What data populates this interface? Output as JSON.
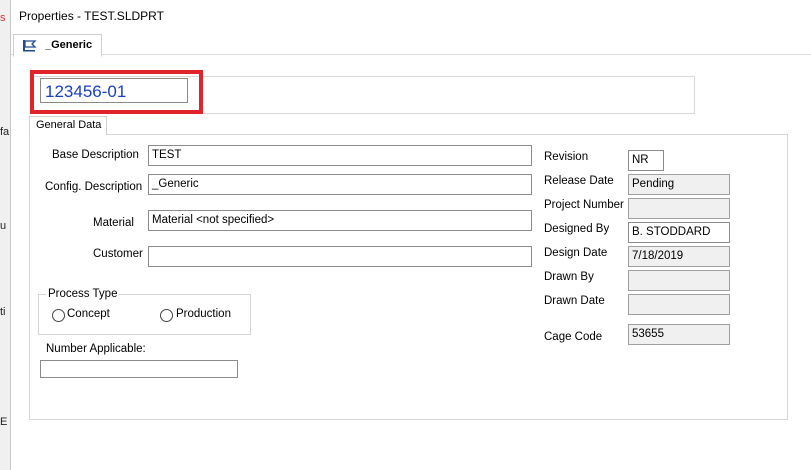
{
  "window": {
    "title": "Properties - TEST.SLDPRT"
  },
  "behind_fragments": [
    "s",
    "fa",
    "u",
    "ti",
    "E"
  ],
  "tabs": {
    "config_tab": "_Generic",
    "general_tab": "General Data"
  },
  "part_number": "123456-01",
  "left_fields": {
    "base_description": {
      "label": "Base Description",
      "value": "TEST"
    },
    "config_description": {
      "label": "Config. Description",
      "value": "_Generic"
    },
    "material": {
      "label": "Material",
      "value": "Material <not specified>"
    },
    "customer": {
      "label": "Customer",
      "value": ""
    }
  },
  "process_type": {
    "legend": "Process Type",
    "options": [
      "Concept",
      "Production"
    ]
  },
  "number_applicable": {
    "label": "Number Applicable:",
    "value": ""
  },
  "right_fields": {
    "revision": {
      "label": "Revision",
      "value": "NR"
    },
    "release_date": {
      "label": "Release Date",
      "value": "Pending"
    },
    "project_number": {
      "label": "Project Number",
      "value": ""
    },
    "designed_by": {
      "label": "Designed By",
      "value": "B. STODDARD"
    },
    "design_date": {
      "label": "Design Date",
      "value": "7/18/2019"
    },
    "drawn_by": {
      "label": "Drawn By",
      "value": ""
    },
    "drawn_date": {
      "label": "Drawn Date",
      "value": ""
    },
    "cage_code": {
      "label": "Cage Code",
      "value": "53655"
    }
  },
  "colors": {
    "highlight": "#e0252a",
    "part_number_text": "#1a3fbf"
  },
  "icons": {
    "config_tab": "configuration-flag-icon"
  }
}
